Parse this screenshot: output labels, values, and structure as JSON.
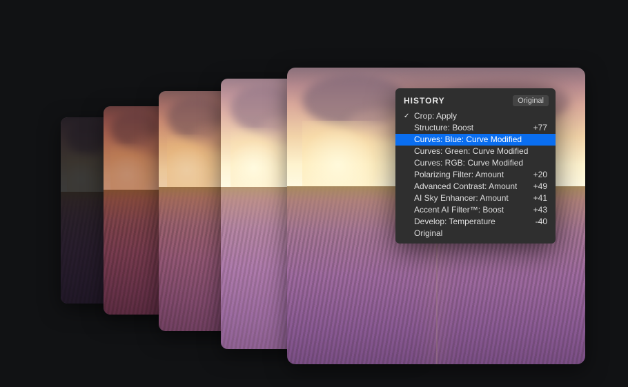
{
  "history": {
    "title": "HISTORY",
    "original_button": "Original",
    "items": [
      {
        "checked": true,
        "selected": false,
        "label": "Crop: Apply",
        "value": ""
      },
      {
        "checked": false,
        "selected": false,
        "label": "Structure: Boost",
        "value": "+77"
      },
      {
        "checked": false,
        "selected": true,
        "label": "Curves: Blue: Curve Modified",
        "value": ""
      },
      {
        "checked": false,
        "selected": false,
        "label": "Curves: Green: Curve Modified",
        "value": ""
      },
      {
        "checked": false,
        "selected": false,
        "label": "Curves: RGB: Curve Modified",
        "value": ""
      },
      {
        "checked": false,
        "selected": false,
        "label": "Polarizing Filter: Amount",
        "value": "+20"
      },
      {
        "checked": false,
        "selected": false,
        "label": "Advanced Contrast: Amount",
        "value": "+49"
      },
      {
        "checked": false,
        "selected": false,
        "label": "AI Sky Enhancer: Amount",
        "value": "+41"
      },
      {
        "checked": false,
        "selected": false,
        "label": "Accent AI Filter™: Boost",
        "value": "+43"
      },
      {
        "checked": false,
        "selected": false,
        "label": "Develop: Temperature",
        "value": "-40"
      },
      {
        "checked": false,
        "selected": false,
        "label": "Original",
        "value": ""
      }
    ]
  }
}
